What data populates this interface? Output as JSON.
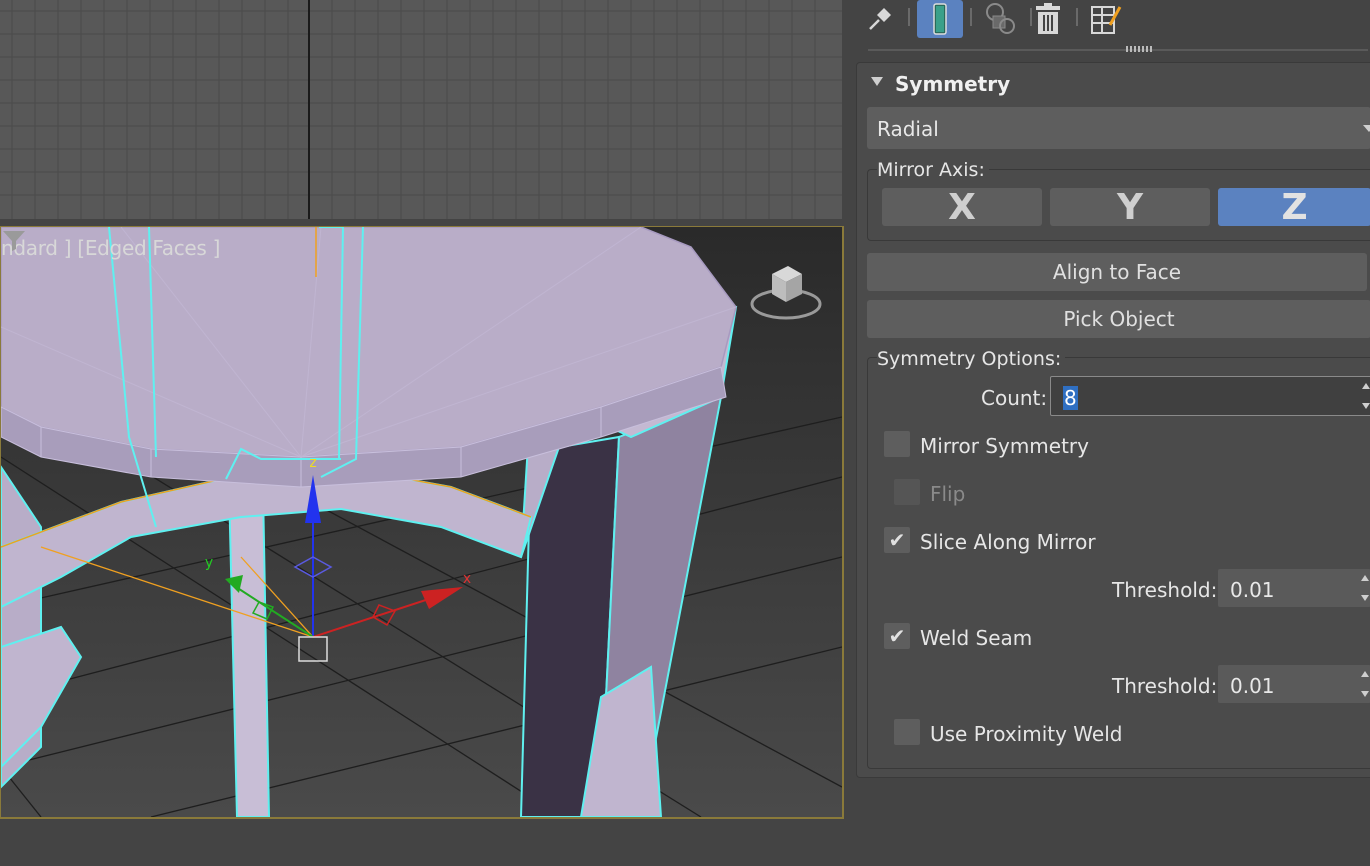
{
  "viewport": {
    "label": "ndard ] [Edged Faces ]",
    "gizmo_axes": {
      "x": "x",
      "y": "y",
      "z": "z"
    }
  },
  "tabs": [
    {
      "icon": "pin-icon"
    },
    {
      "icon": "modifier-tube-icon",
      "active": true
    },
    {
      "icon": "make-unique-icon"
    },
    {
      "icon": "trash-icon"
    },
    {
      "icon": "configure-sets-icon"
    }
  ],
  "rollout": {
    "title": "Symmetry",
    "mode_dropdown": "Radial",
    "mirror_axis": {
      "label": "Mirror Axis:",
      "buttons": [
        "X",
        "Y",
        "Z"
      ],
      "active": "Z"
    },
    "align_to_face": "Align to Face",
    "pick_object": "Pick Object",
    "options": {
      "label": "Symmetry Options:",
      "count_label": "Count:",
      "count_value": "8",
      "mirror_symmetry": {
        "label": "Mirror Symmetry",
        "checked": false
      },
      "flip": {
        "label": "Flip",
        "checked": false,
        "disabled": true
      },
      "slice_along_mirror": {
        "label": "Slice Along Mirror",
        "checked": true
      },
      "slice_threshold_label": "Threshold:",
      "slice_threshold_value": "0.01",
      "weld_seam": {
        "label": "Weld Seam",
        "checked": true
      },
      "weld_threshold_label": "Threshold:",
      "weld_threshold_value": "0.01",
      "use_proximity_weld": {
        "label": "Use Proximity Weld",
        "checked": false
      }
    }
  },
  "colors": {
    "active_blue": "#5b82c0",
    "selection_cyan": "#5ff0f0",
    "mesh_lavender": "#b9adc8",
    "gizmo_orange": "#f0a020"
  }
}
